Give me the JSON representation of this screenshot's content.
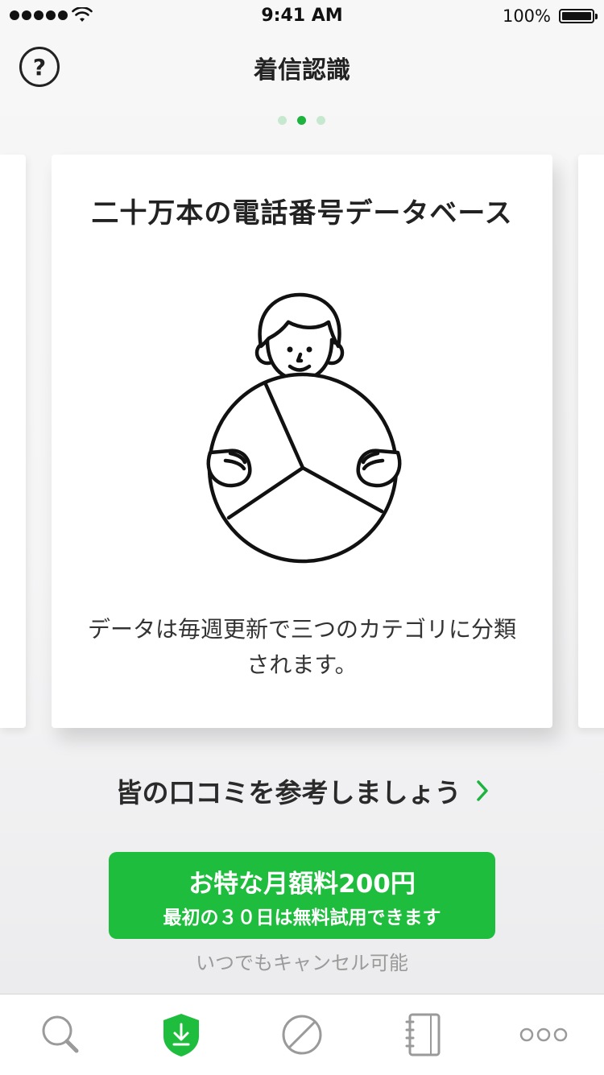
{
  "status_bar": {
    "time": "9:41 AM",
    "battery_percent": "100%",
    "signal_bars": 5,
    "icons": [
      "signal-dots-icon",
      "wifi-icon",
      "battery-icon"
    ]
  },
  "nav": {
    "title": "着信認識",
    "help_label": "?",
    "help_icon": "question-circle-icon"
  },
  "pager": {
    "total": 3,
    "active_index": 1
  },
  "card": {
    "title": "二十万本の電話番号データベース",
    "description_line1": "データは毎週更新で三つのカテゴリに分類",
    "description_line2": "されます。",
    "illustration": "person-holding-pie-chart-illustration"
  },
  "reviews_link": {
    "label": "皆の口コミを参考しましょう",
    "icon": "chevron-right-icon",
    "icon_color": "#1db33e"
  },
  "cta": {
    "main": "お特な月額料200円",
    "sub": "最初の３０日は無料試用できます",
    "color": "#1fbd3d"
  },
  "cancel_note": "いつでもキャンセル可能",
  "tab_bar": {
    "tabs": [
      {
        "name": "search",
        "icon": "search-icon",
        "active": false
      },
      {
        "name": "shield",
        "icon": "shield-download-icon",
        "active": true
      },
      {
        "name": "block",
        "icon": "block-icon",
        "active": false
      },
      {
        "name": "notebook",
        "icon": "notebook-icon",
        "active": false
      },
      {
        "name": "more",
        "icon": "more-icon",
        "active": false
      }
    ],
    "active_color": "#1fbd3d",
    "inactive_color": "#9a9a9a"
  }
}
